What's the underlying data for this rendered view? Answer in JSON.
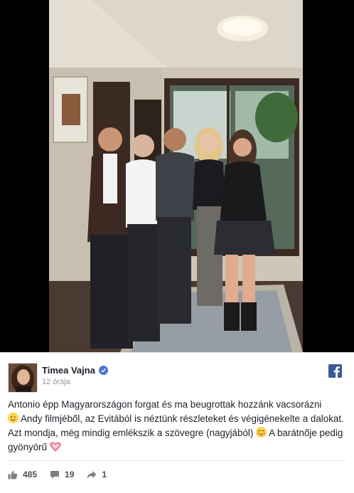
{
  "post": {
    "author": "Timea Vajna",
    "time": "12 órája",
    "text_1": "Antonio épp Magyarországon forgat és ma beugrottak hozzánk vacsorázni",
    "text_2": "Andy filmjéből, az Evitából is néztünk részleteket és végigénekelte a dalokat. Azt mondja, még mindig emlékszik a szövegre (nagyjából)",
    "text_3": "A barátnője pedig gyönyörű"
  },
  "emojis": {
    "wink": "wink-emoji",
    "blush": "smiling-blush-emoji",
    "heart": "sparkling-heart-emoji"
  },
  "stats": {
    "likes": "485",
    "comments": "19",
    "shares": "1"
  },
  "icons": {
    "verified": "verified-badge-icon",
    "facebook": "facebook-logo-icon",
    "like": "thumbs-up-icon",
    "comment": "comment-bubble-icon",
    "share": "share-arrow-icon"
  },
  "colors": {
    "facebook_blue": "#3b5998",
    "verified_blue": "#4a76d0",
    "text": "#1d2129",
    "muted": "#90949c"
  }
}
